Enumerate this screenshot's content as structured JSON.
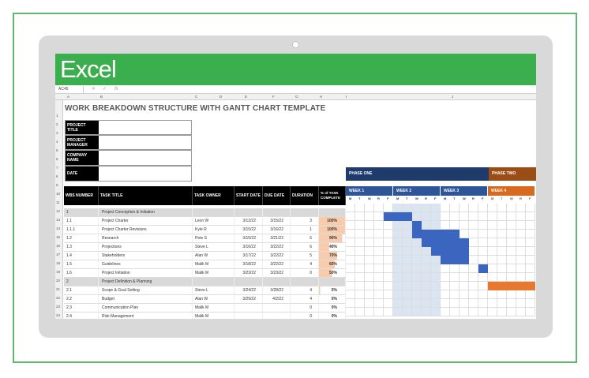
{
  "app": {
    "name": "Excel",
    "name_box": "AC45",
    "formula_icon": "fx",
    "cancel_icon": "x-icon",
    "enter_icon": "check-icon"
  },
  "columns": [
    "A",
    "B",
    "C",
    "D",
    "E",
    "F",
    "G",
    "H",
    "I",
    "J"
  ],
  "row_numbers": [
    "1",
    "2",
    "3",
    "4",
    "5",
    "6",
    "7",
    "8",
    "9",
    "10",
    "11",
    "12",
    "13",
    "14",
    "15",
    "16",
    "17",
    "18",
    "19",
    "20",
    "21",
    "22",
    "23",
    "24",
    "25"
  ],
  "sheet": {
    "title": "WORK BREAKDOWN STRUCTURE WITH GANTT CHART TEMPLATE",
    "project_info": [
      {
        "label": "PROJECT TITLE",
        "value": ""
      },
      {
        "label": "PROJECT MANAGER",
        "value": ""
      },
      {
        "label": "COMPANY NAME",
        "value": ""
      },
      {
        "label": "DATE",
        "value": ""
      }
    ],
    "headers": [
      "WBS NUMBER",
      "TASK TITLE",
      "TASK OWNER",
      "START DATE",
      "DUE DATE",
      "DURATION",
      "% of TASK COMPLETE"
    ],
    "rows": [
      {
        "wbs": "1",
        "title": "Project Conception & Initiation",
        "owner": "",
        "start": "",
        "due": "",
        "duration": "",
        "pct": "",
        "parent": true
      },
      {
        "wbs": "1.1",
        "title": "Project Charter",
        "owner": "Leon W",
        "start": "3/12/22",
        "due": "3/15/22",
        "duration": "3",
        "pct": "100%",
        "pct_value": 1.0
      },
      {
        "wbs": "1.1.1",
        "title": "Project Charter Revisions",
        "owner": "Kyle R",
        "start": "3/15/22",
        "due": "3/16/22",
        "duration": "1",
        "pct": "100%",
        "pct_value": 1.0
      },
      {
        "wbs": "1.2",
        "title": "Research",
        "owner": "Pete S",
        "start": "3/15/22",
        "due": "3/21/22",
        "duration": "6",
        "pct": "90%",
        "pct_value": 0.9
      },
      {
        "wbs": "1.3",
        "title": "Projections",
        "owner": "Steve L",
        "start": "3/16/22",
        "due": "3/22/22",
        "duration": "6",
        "pct": "40%",
        "pct_value": 0.4
      },
      {
        "wbs": "1.4",
        "title": "Stakeholders",
        "owner": "Alan W",
        "start": "3/17/22",
        "due": "3/22/22",
        "duration": "5",
        "pct": "70%",
        "pct_value": 0.7
      },
      {
        "wbs": "1.5",
        "title": "Guidelines",
        "owner": "Malik M",
        "start": "3/18/22",
        "due": "3/22/22",
        "duration": "4",
        "pct": "60%",
        "pct_value": 0.6
      },
      {
        "wbs": "1.6",
        "title": "Project Initiation",
        "owner": "Malik M",
        "start": "3/23/22",
        "due": "3/23/22",
        "duration": "0",
        "pct": "50%",
        "pct_value": 0.5
      },
      {
        "wbs": "2",
        "title": "Project Definition & Planning",
        "owner": "",
        "start": "",
        "due": "",
        "duration": "",
        "pct": "",
        "parent": true
      },
      {
        "wbs": "2.1",
        "title": "Scope & Goal Setting",
        "owner": "Steve L",
        "start": "3/24/22",
        "due": "3/28/22",
        "duration": "4",
        "pct": "5%",
        "pct_value": 0.05
      },
      {
        "wbs": "2.2",
        "title": "Budget",
        "owner": "Alan W",
        "start": "3/29/22",
        "due": "4/2/22",
        "duration": "4",
        "pct": "0%",
        "pct_value": 0
      },
      {
        "wbs": "2.3",
        "title": "Communication Plan",
        "owner": "Malik M",
        "start": "",
        "due": "",
        "duration": "0",
        "pct": "0%",
        "pct_value": 0
      },
      {
        "wbs": "2.4",
        "title": "Risk Management",
        "owner": "Malik M",
        "start": "",
        "due": "",
        "duration": "0",
        "pct": "0%",
        "pct_value": 0
      }
    ],
    "phases": [
      "PHASE ONE",
      "PHASE TWO"
    ],
    "weeks": [
      "WEEK 1",
      "WEEK 2",
      "WEEK 3",
      "WEEK 4"
    ],
    "days": [
      "M",
      "T",
      "W",
      "R",
      "F",
      "S",
      "S"
    ],
    "colors": {
      "phase_one": "#1f3b6b",
      "phase_two": "#9a4e15",
      "week_blue": "#2e5597",
      "week_orange": "#d86a20",
      "task_bar": "#3b66bf",
      "phase2_bar": "#e8782e",
      "pct_bar": "#f8cbad",
      "header_bg": "#000000",
      "brand": "#3bae4e"
    }
  }
}
